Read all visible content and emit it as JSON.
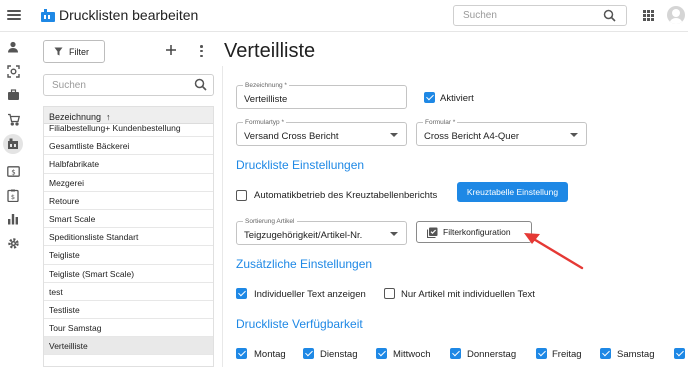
{
  "header": {
    "title": "Drucklisten bearbeiten",
    "search_placeholder": "Suchen"
  },
  "nav_rail": {
    "icons": [
      "person-icon",
      "scan-icon",
      "briefcase-icon",
      "cart-icon",
      "store-icon",
      "cash-icon",
      "clipboard-money-icon",
      "bar-chart-icon",
      "gear-icon"
    ],
    "active": "store-icon"
  },
  "list_panel": {
    "filter_label": "Filter",
    "search_placeholder": "Suchen",
    "column_header": "Bezeichnung",
    "sort_indicator": "↑",
    "items": [
      "Filialbestellung+ Kundenbestellung",
      "Gesamtliste Bäckerei",
      "Halbfabrikate",
      "Mezgerei",
      "Retoure",
      "Smart Scale",
      "Speditionsliste Standart",
      "Teigliste",
      "Teigliste (Smart Scale)",
      "test",
      "Testliste",
      "Tour Samstag",
      "Verteilliste"
    ],
    "selected": "Verteilliste"
  },
  "detail": {
    "title": "Verteilliste",
    "bezeichnung": {
      "label": "Bezeichnung *",
      "value": "Verteilliste"
    },
    "aktiviert": {
      "label": "Aktiviert",
      "checked": true
    },
    "formulartyp": {
      "label": "Formulartyp *",
      "value": "Versand Cross Bericht"
    },
    "formular": {
      "label": "Formular *",
      "value": "Cross Bericht A4-Quer"
    },
    "section_druckliste": "Druckliste Einstellungen",
    "automatik": {
      "label": "Automatikbetrieb des Kreuztabellenberichts",
      "checked": false
    },
    "kreuztabelle_button": "Kreuztabelle Einstellung",
    "sortierung": {
      "label": "Sortierung Artikel",
      "value": "Teigzugehörigkeit/Artikel-Nr."
    },
    "filter_button": "Filterkonfiguration",
    "section_zusaetzlich": "Zusätzliche Einstellungen",
    "individueller_text": {
      "label": "Individueller Text anzeigen",
      "checked": true
    },
    "nur_artikel": {
      "label": "Nur Artikel mit individuellen Text",
      "checked": false
    },
    "section_verfuegbarkeit": "Druckliste Verfügbarkeit",
    "days": [
      {
        "label": "Montag",
        "checked": true
      },
      {
        "label": "Dienstag",
        "checked": true
      },
      {
        "label": "Mittwoch",
        "checked": true
      },
      {
        "label": "Donnerstag",
        "checked": true
      },
      {
        "label": "Freitag",
        "checked": true
      },
      {
        "label": "Samstag",
        "checked": true
      }
    ]
  },
  "colors": {
    "accent": "#1e88e5",
    "annotation_arrow": "#e53935"
  }
}
